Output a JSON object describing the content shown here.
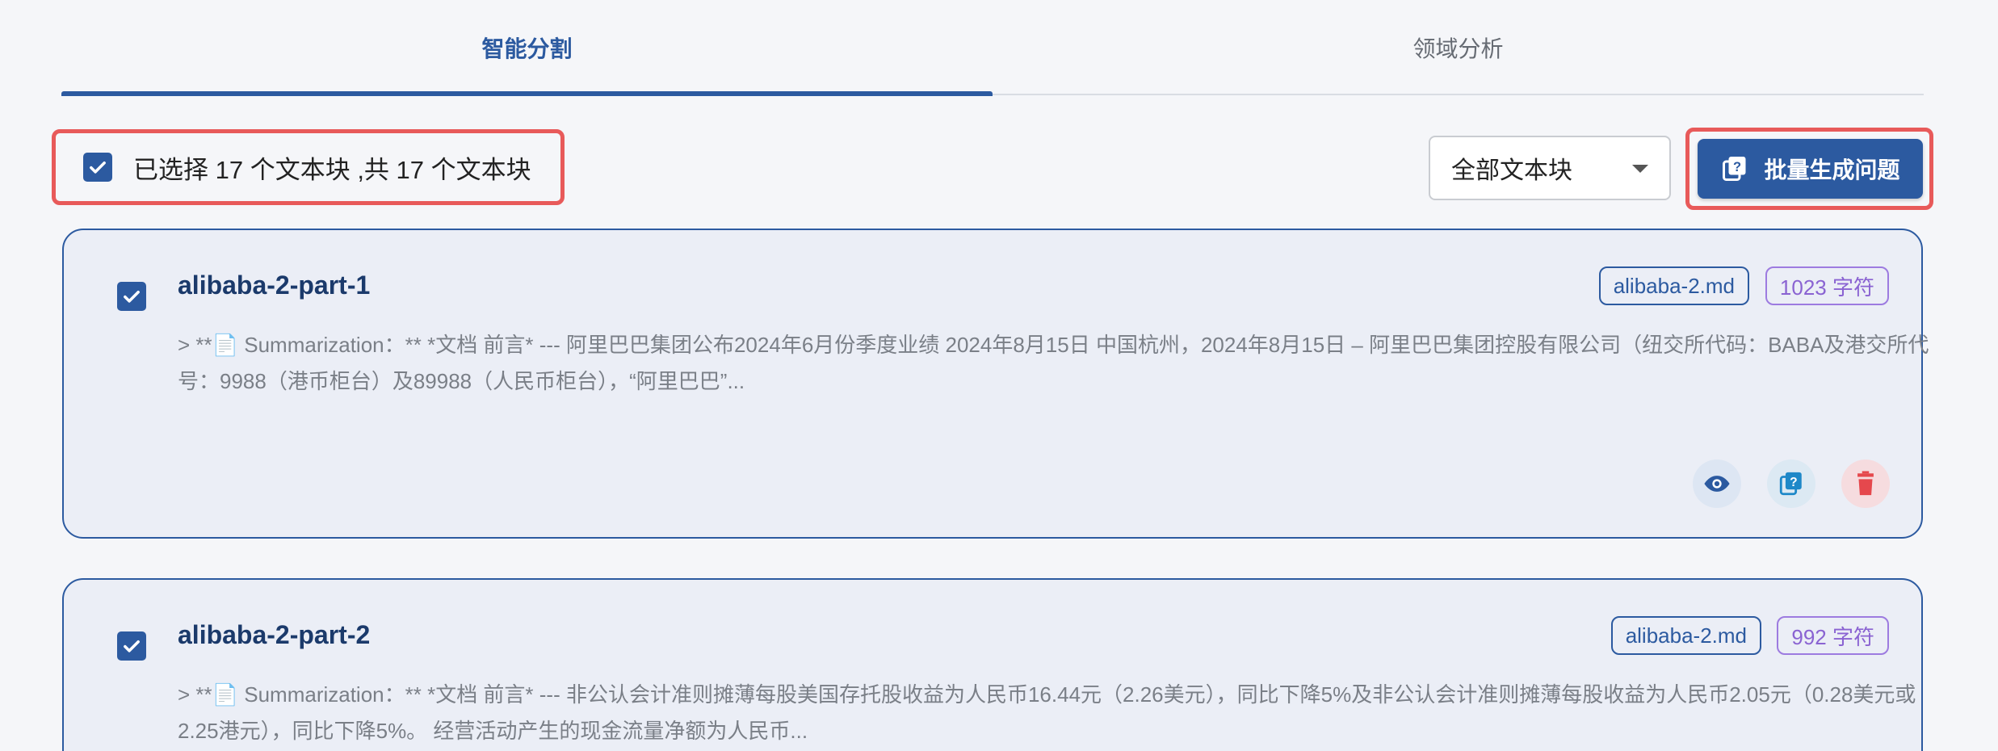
{
  "tabs": [
    {
      "label": "智能分割",
      "active": true
    },
    {
      "label": "领域分析",
      "active": false
    }
  ],
  "toolbar": {
    "selection_summary": "已选择 17 个文本块 ,共 17 个文本块",
    "filter_value": "全部文本块",
    "batch_button_label": "批量生成问题"
  },
  "chunks": [
    {
      "title": "alibaba-2-part-1",
      "file_tag": "alibaba-2.md",
      "char_tag": "1023 字符",
      "content": "> **📄 Summarization：** *文档 前言* --- 阿里巴巴集团公布2024年6月份季度业绩 2024年8月15日 中国杭州，2024年8月15日 – 阿里巴巴集团控股有限公司（纽交所代码：BABA及港交所代号：9988（港币柜台）及89988（人民币柜台），“阿里巴巴”..."
    },
    {
      "title": "alibaba-2-part-2",
      "file_tag": "alibaba-2.md",
      "char_tag": "992 字符",
      "content": "> **📄 Summarization：** *文档 前言* --- 非公认会计准则摊薄每股美国存托股收益为人民币16.44元（2.26美元），同比下降5%及非公认会计准则摊薄每股收益为人民币2.05元（0.28美元或2.25港元），同比下降5%。 经营活动产生的现金流量净额为人民币..."
    }
  ],
  "colors": {
    "primary": "#2c5aa0",
    "highlight_border": "#e85a5a",
    "char_tag": "#8a63d2",
    "delete": "#e5484d"
  },
  "icons": {
    "checkbox": "check-icon",
    "batch": "question-stack-icon",
    "view": "eye-icon",
    "generate": "question-stack-icon",
    "delete": "trash-icon"
  }
}
